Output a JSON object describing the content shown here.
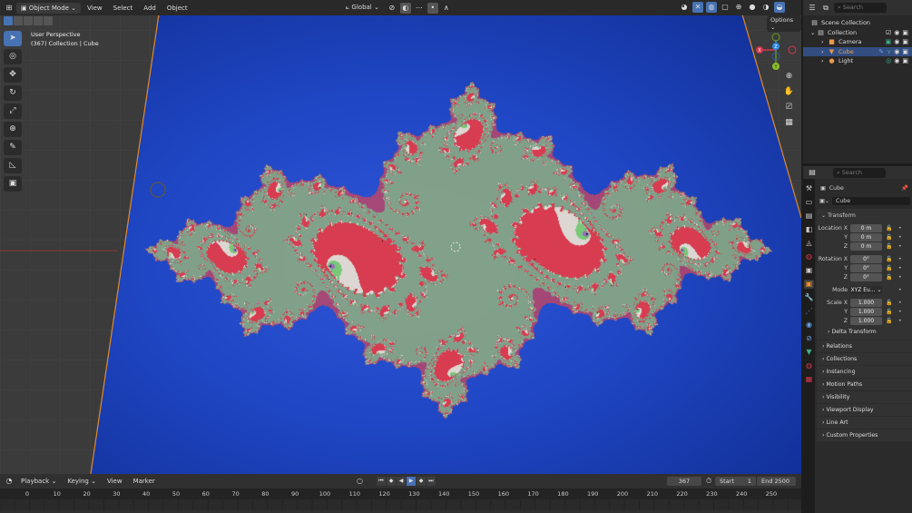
{
  "header": {
    "editor_icon": "view3d-icon",
    "mode": "Object Mode",
    "menus": [
      "View",
      "Select",
      "Add",
      "Object"
    ],
    "transform_orientation": "Global",
    "options_label": "Options"
  },
  "viewport": {
    "perspective": "User Perspective",
    "collection_info": "(367) Collection | Cube",
    "background_color": "#1f46c4",
    "fractal": {
      "type": "julia",
      "c_real": -0.75,
      "c_imag": 0.11
    }
  },
  "gizmo": {
    "x": "X",
    "y": "Y",
    "z": "Z"
  },
  "outliner": {
    "search_placeholder": "Search",
    "scene_collection": "Scene Collection",
    "collection": "Collection",
    "objects": [
      {
        "name": "Camera",
        "selected": false
      },
      {
        "name": "Cube",
        "selected": true
      },
      {
        "name": "Light",
        "selected": false
      }
    ]
  },
  "properties": {
    "search_placeholder": "Search",
    "object_name": "Cube",
    "data_name": "Cube",
    "transform_label": "Transform",
    "location": {
      "label": "Location X",
      "x": "0 m",
      "y": "0 m",
      "z": "0 m"
    },
    "rotation": {
      "label": "Rotation X",
      "x": "0°",
      "y": "0°",
      "z": "0°"
    },
    "mode_label": "Mode",
    "mode_value": "XYZ Eu...",
    "scale": {
      "label": "Scale X",
      "x": "1.000",
      "y": "1.000",
      "z": "1.000"
    },
    "axis": {
      "y": "Y",
      "z": "Z"
    },
    "panels": [
      "Delta Transform",
      "Relations",
      "Collections",
      "Instancing",
      "Motion Paths",
      "Visibility",
      "Viewport Display",
      "Line Art",
      "Custom Properties"
    ]
  },
  "timeline": {
    "menus": [
      "Playback",
      "Keying",
      "View",
      "Marker"
    ],
    "current_frame": "367",
    "start_label": "Start",
    "start": "1",
    "end_label": "End",
    "end": "2500",
    "ticks": [
      "0",
      "10",
      "20",
      "30",
      "40",
      "50",
      "60",
      "70",
      "80",
      "90",
      "100",
      "110",
      "120",
      "130",
      "140",
      "150",
      "160",
      "170",
      "180",
      "190",
      "200",
      "210",
      "220",
      "230",
      "240",
      "250"
    ]
  }
}
